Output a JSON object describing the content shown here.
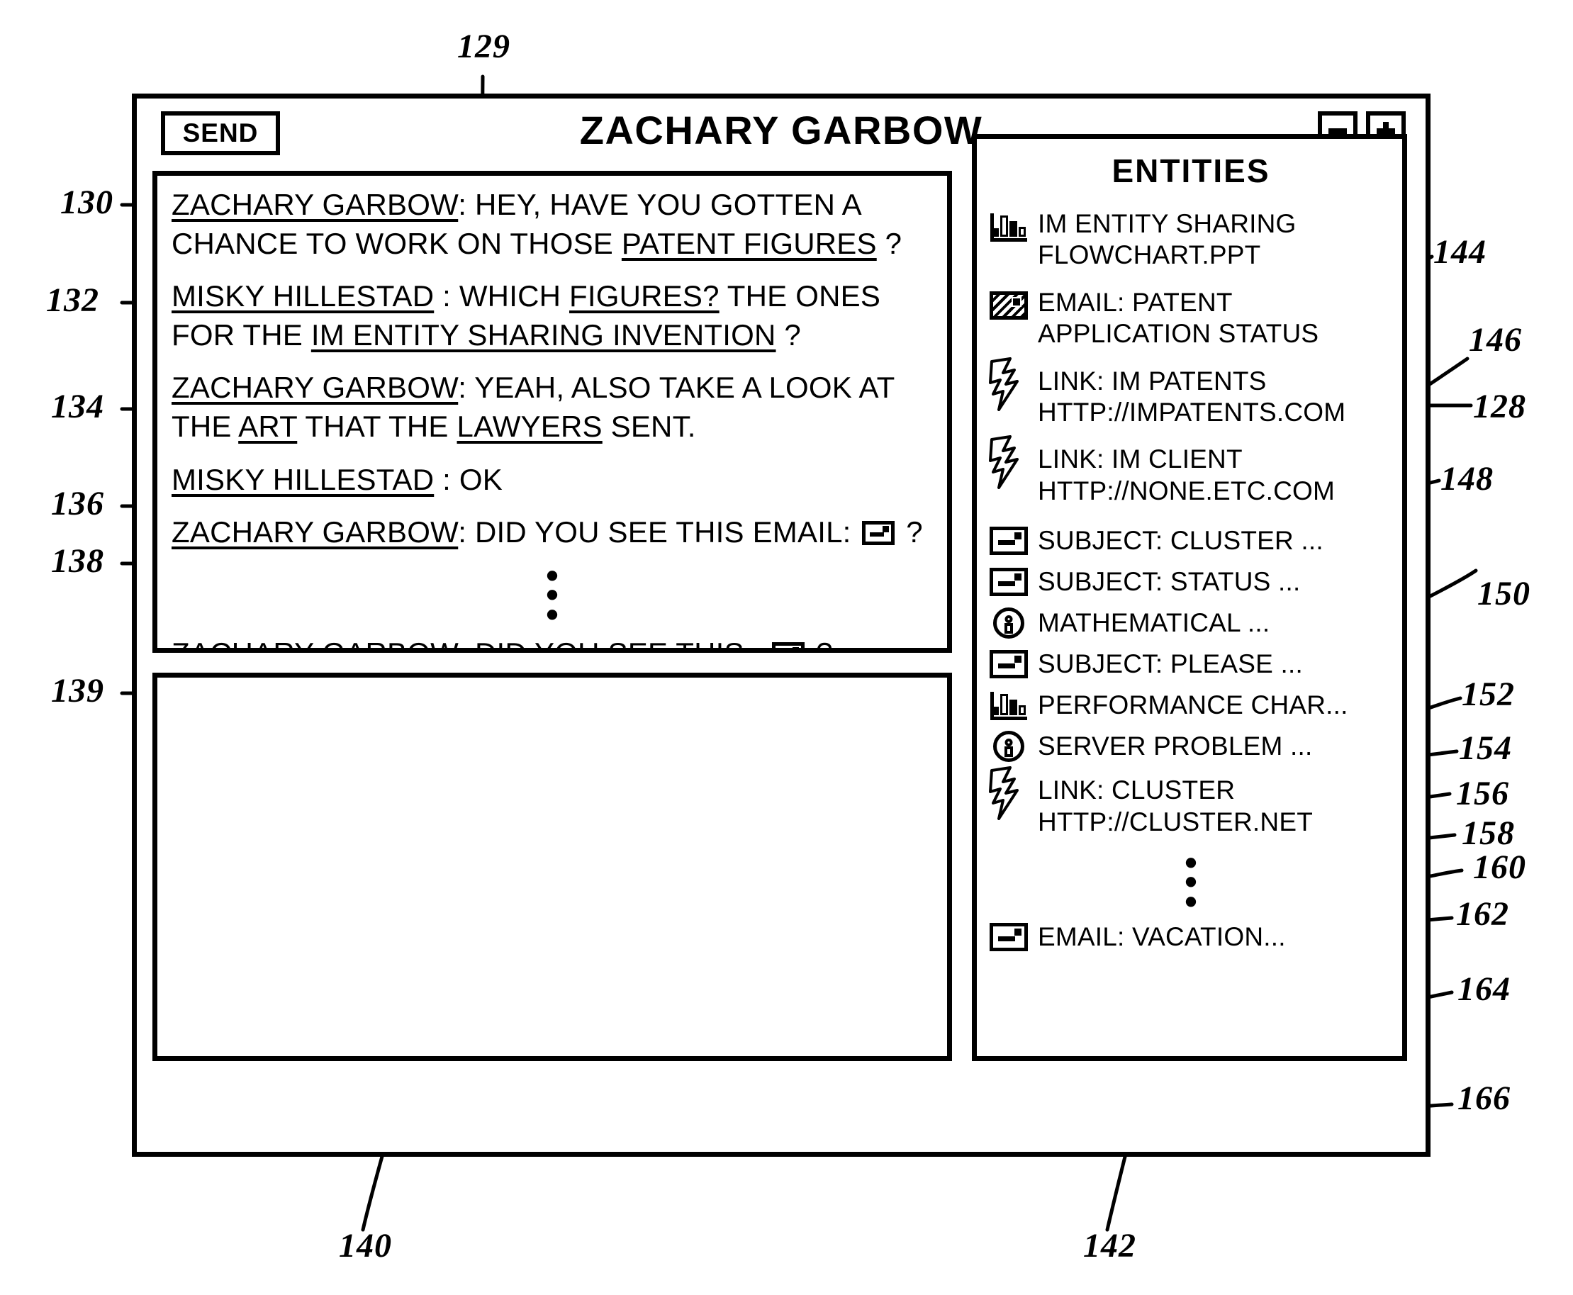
{
  "window": {
    "title": "ZACHARY GARBOW",
    "send_label": "SEND",
    "minimize_label": "–",
    "maximize_label": "+"
  },
  "transcript": {
    "messages": [
      {
        "ref": "130",
        "sender": "ZACHARY GARBOW",
        "text_before": ": HEY, HAVE YOU GOTTEN A CHANCE TO WORK ON THOSE ",
        "highlight": "PATENT FIGURES",
        "text_after": " ?"
      },
      {
        "ref": "132",
        "sender": "MISKY  HILLESTAD",
        "text_before": " : WHICH ",
        "highlight": "FIGURES?",
        "text_mid": " THE ONES FOR THE ",
        "highlight2": "IM ENTITY SHARING INVENTION",
        "text_after": "    ?"
      },
      {
        "ref": "134",
        "sender": "ZACHARY GARBOW",
        "text_before": ": YEAH, ALSO TAKE A LOOK AT THE ",
        "highlight": "ART",
        "text_mid": " THAT THE ",
        "highlight2": "LAWYERS",
        "text_after": " SENT."
      },
      {
        "ref": "136",
        "sender": "MISKY  HILLESTAD",
        "text_before": " : OK",
        "highlight": "",
        "text_after": ""
      },
      {
        "ref": "138",
        "sender": "ZACHARY GARBOW",
        "text_before": ": DID YOU SEE THIS EMAIL:  ",
        "icon": "email-icon",
        "text_after": " ?"
      },
      {
        "ref": "139",
        "sender": "ZACHARY GARBOW",
        "text_before": ": DID YOU SEE THIS :  ",
        "icon": "email-icon",
        "text_after": " ?"
      }
    ],
    "ellipsis": "•"
  },
  "compose": {
    "ref": "140",
    "value": "",
    "placeholder": ""
  },
  "entities": {
    "ref": "142",
    "title": "ENTITIES",
    "items": [
      {
        "ref": "144",
        "icon": "chart-icon",
        "label": "IM ENTITY SHARING FLOWCHART.PPT",
        "compact": false
      },
      {
        "ref": "146",
        "icon": "email-hatch-icon",
        "label": "EMAIL: PATENT APPLICATION STATUS",
        "compact": false
      },
      {
        "ref": "148",
        "icon": "bolt-icon",
        "label": "LINK: IM PATENTS HTTP://IMPATENTS.COM",
        "compact": false
      },
      {
        "ref": "150",
        "icon": "bolt-icon",
        "label": "LINK: IM CLIENT HTTP://NONE.ETC.COM",
        "compact": false
      },
      {
        "ref": "152",
        "icon": "email-icon",
        "label": "SUBJECT: CLUSTER ...",
        "compact": true
      },
      {
        "ref": "154",
        "icon": "email-icon",
        "label": "SUBJECT: STATUS ...",
        "compact": true
      },
      {
        "ref": "156",
        "icon": "circle-icon",
        "label": "MATHEMATICAL ...",
        "compact": true
      },
      {
        "ref": "158",
        "icon": "email-icon",
        "label": "SUBJECT: PLEASE ...",
        "compact": true
      },
      {
        "ref": "160",
        "icon": "chart-icon",
        "label": "PERFORMANCE CHAR...",
        "compact": true
      },
      {
        "ref": "162",
        "icon": "circle-icon",
        "label": "SERVER PROBLEM ...",
        "compact": true
      },
      {
        "ref": "164",
        "icon": "bolt-icon",
        "label": "LINK: CLUSTER HTTP://CLUSTER.NET",
        "compact": false
      },
      {
        "ref": "166",
        "icon": "email-icon",
        "label": "EMAIL: VACATION...",
        "compact": true
      }
    ],
    "ellipsis": "•"
  },
  "figure_refs": {
    "r129": "129",
    "r128": "128",
    "r130": "130",
    "r132": "132",
    "r134": "134",
    "r136": "136",
    "r138": "138",
    "r139": "139",
    "r140": "140",
    "r142": "142",
    "r144": "144",
    "r146": "146",
    "r148": "148",
    "r150": "150",
    "r152": "152",
    "r154": "154",
    "r156": "156",
    "r158": "158",
    "r160": "160",
    "r162": "162",
    "r164": "164",
    "r166": "166"
  },
  "colors": {
    "ink": "#000000",
    "paper": "#ffffff"
  }
}
